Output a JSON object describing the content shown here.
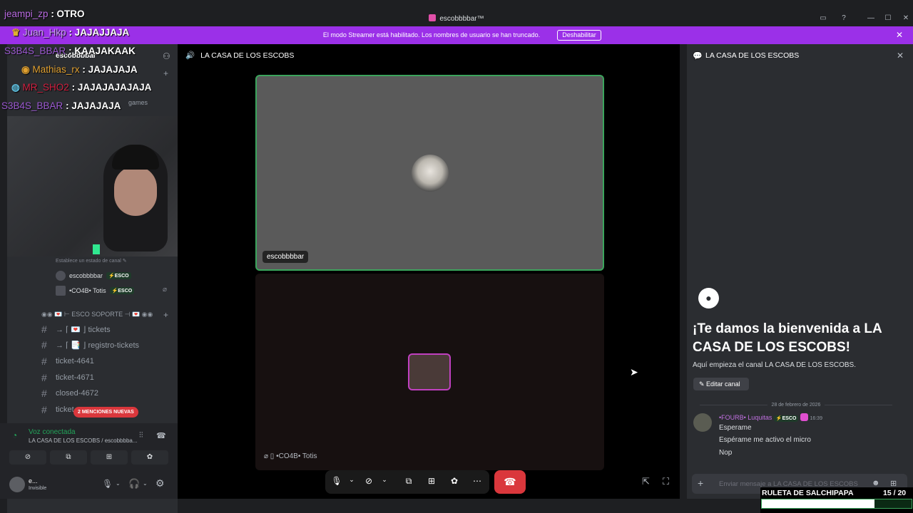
{
  "window": {
    "title": "escobbbbar™"
  },
  "banner": {
    "text": "El modo Streamer está habilitado. Los nombres de usuario se han truncado.",
    "button": "Deshabilitar"
  },
  "overlay_chat": [
    {
      "user": "jeampi_zp",
      "text": ": OTRO",
      "color": "#b86ae0"
    },
    {
      "user": "Juan_Hkp",
      "text": ": JAJAJJAJA",
      "color": "#b86ae0"
    },
    {
      "user": "S3B4S_BBAR",
      "text": ": KAAJAKAAK",
      "color": "#9b59d0"
    },
    {
      "user": "Mathias_rx",
      "text": ": JAJAJAJA",
      "color": "#e0a030"
    },
    {
      "user": "MR_SHO2",
      "text": ": JAJAJAJAJAJA",
      "color": "#d02040"
    },
    {
      "user": "S3B4S_BBAR",
      "text": ": JAJAJAJA",
      "color": "#9b59d0"
    }
  ],
  "sidebar": {
    "server_name": "escobbbbar",
    "games_label": "games",
    "status_hint": "Establece un estado de canal",
    "voice_users": [
      {
        "name": "escobbbbar",
        "tag": "ESCO"
      },
      {
        "name": "•CO4B• Totis",
        "tag": "ESCO"
      }
    ],
    "category": "◉◉ 💌 ⊢ ESCO SOPORTE ⊣ 💌 ◉◉",
    "channels": [
      {
        "label": "→ ⌈ 💌 ⌋ tickets"
      },
      {
        "label": "→ ⌈ 📑 ⌋ registro-tickets"
      },
      {
        "label": "ticket-4641"
      },
      {
        "label": "ticket-4671"
      },
      {
        "label": "closed-4672"
      },
      {
        "label": "ticket"
      }
    ],
    "mentions_badge": "2 MENCIONES NUEVAS",
    "voice_status": "Voz conectada",
    "voice_location": "LA CASA DE LOS ESCOBS / escobbbba...",
    "user_name": "e...",
    "user_status": "Invisible"
  },
  "stage": {
    "channel_name": "LA CASA DE LOS ESCOBS",
    "tile1_name": "escobbbbar",
    "tile2_name": "•CO4B• Totis"
  },
  "chat": {
    "channel_name": "LA CASA DE LOS ESCOBS",
    "welcome_title": "¡Te damos la bienvenida a LA CASA DE LOS ESCOBS!",
    "welcome_sub": "Aquí empieza el canal LA CASA DE LOS ESCOBS.",
    "edit_button": "Editar canal",
    "date": "28 de febrero de 2026",
    "message_user": "•FOURB• Luquitas",
    "message_tag": "ESCO",
    "message_time": "16:39",
    "messages": [
      "Esperame",
      "Espérame me activo el micro",
      "Nop"
    ],
    "input_placeholder": "Enviar mensaje a LA CASA DE LOS ESCOBS"
  },
  "ruleta": {
    "label": "RULETA DE SALCHIPAPA",
    "count": "15",
    "total": "/ 20",
    "progress": 0.75
  }
}
